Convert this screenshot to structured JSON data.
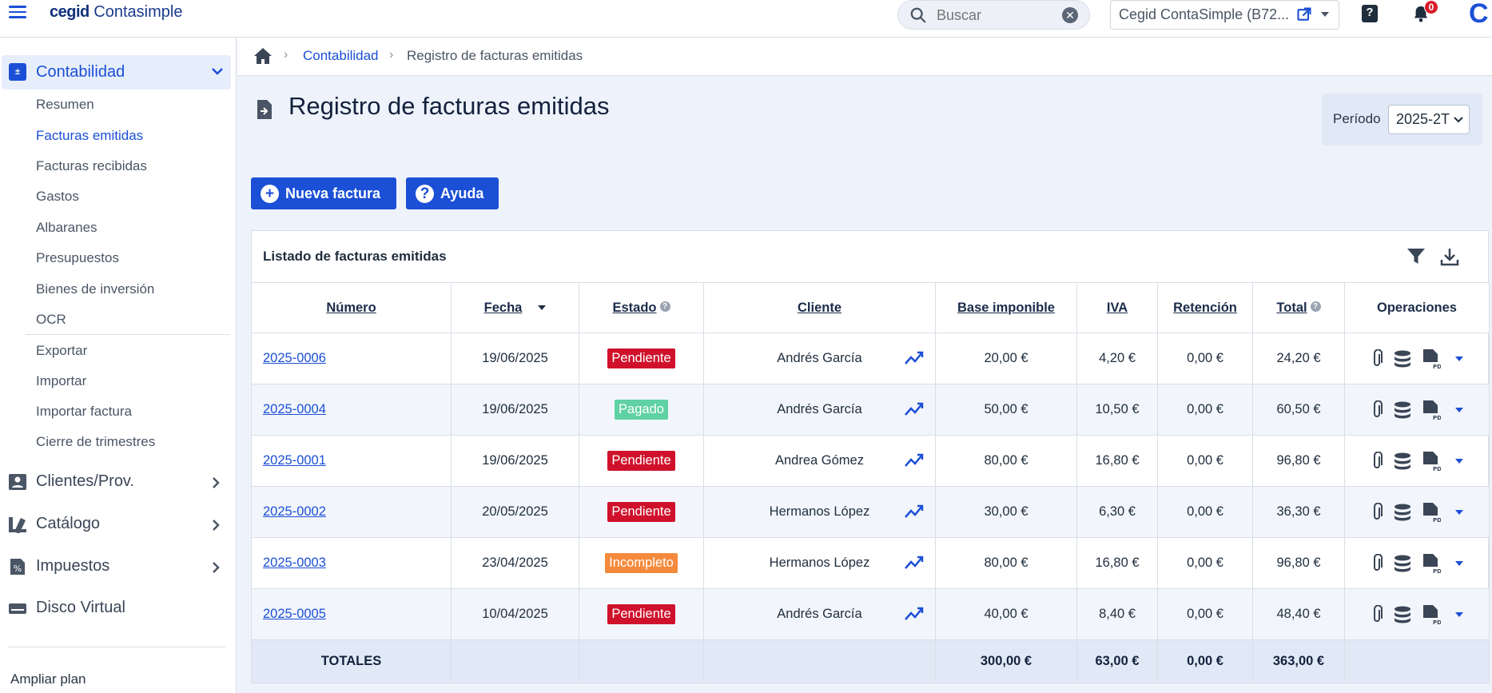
{
  "app": {
    "logo_bold": "cegid",
    "logo_rest": " Contasimple"
  },
  "topbar": {
    "search_placeholder": "Buscar",
    "company": "Cegid ContaSimple (B72...",
    "notifications": "0",
    "help": "?",
    "brand_mark": "C"
  },
  "sidebar": {
    "section": "Contabilidad",
    "items": [
      "Resumen",
      "Facturas emitidas",
      "Facturas recibidas",
      "Gastos",
      "Albaranes",
      "Presupuestos",
      "Bienes de inversión",
      "OCR",
      "Exportar",
      "Importar",
      "Importar factura",
      "Cierre de trimestres"
    ],
    "active_item": "Facturas emitidas",
    "sections": [
      "Clientes/Prov.",
      "Catálogo",
      "Impuestos",
      "Disco Virtual"
    ],
    "upgrade": "Ampliar plan"
  },
  "breadcrumb": {
    "link": "Contabilidad",
    "current": "Registro de facturas emitidas"
  },
  "page": {
    "title": "Registro de facturas emitidas",
    "period_label": "Período",
    "period_value": "2025-2T"
  },
  "buttons": {
    "new_invoice": "Nueva factura",
    "help": "Ayuda"
  },
  "table": {
    "title": "Listado de facturas emitidas",
    "headers": {
      "number": "Número",
      "date": "Fecha",
      "status": "Estado",
      "client": "Cliente",
      "base": "Base imponible",
      "vat": "IVA",
      "retention": "Retención",
      "total": "Total",
      "operations": "Operaciones"
    },
    "rows": [
      {
        "number": "2025-0006",
        "date": "19/06/2025",
        "status": "Pendiente",
        "client": "Andrés García",
        "base": "20,00 €",
        "vat": "4,20 €",
        "retention": "0,00 €",
        "total": "24,20 €"
      },
      {
        "number": "2025-0004",
        "date": "19/06/2025",
        "status": "Pagado",
        "client": "Andrés García",
        "base": "50,00 €",
        "vat": "10,50 €",
        "retention": "0,00 €",
        "total": "60,50 €"
      },
      {
        "number": "2025-0001",
        "date": "19/06/2025",
        "status": "Pendiente",
        "client": "Andrea Gómez",
        "base": "80,00 €",
        "vat": "16,80 €",
        "retention": "0,00 €",
        "total": "96,80 €"
      },
      {
        "number": "2025-0002",
        "date": "20/05/2025",
        "status": "Pendiente",
        "client": "Hermanos López",
        "base": "30,00 €",
        "vat": "6,30 €",
        "retention": "0,00 €",
        "total": "36,30 €"
      },
      {
        "number": "2025-0003",
        "date": "23/04/2025",
        "status": "Incompleto",
        "client": "Hermanos López",
        "base": "80,00 €",
        "vat": "16,80 €",
        "retention": "0,00 €",
        "total": "96,80 €"
      },
      {
        "number": "2025-0005",
        "date": "10/04/2025",
        "status": "Pendiente",
        "client": "Andrés García",
        "base": "40,00 €",
        "vat": "8,40 €",
        "retention": "0,00 €",
        "total": "48,40 €"
      }
    ],
    "totals": {
      "label": "TOTALES",
      "base": "300,00 €",
      "vat": "63,00 €",
      "retention": "0,00 €",
      "total": "363,00 €"
    }
  },
  "colors": {
    "accent": "#1b4fd6",
    "pending": "#d0112b",
    "paid": "#5fd1a2",
    "incomplete": "#f58a3c"
  }
}
